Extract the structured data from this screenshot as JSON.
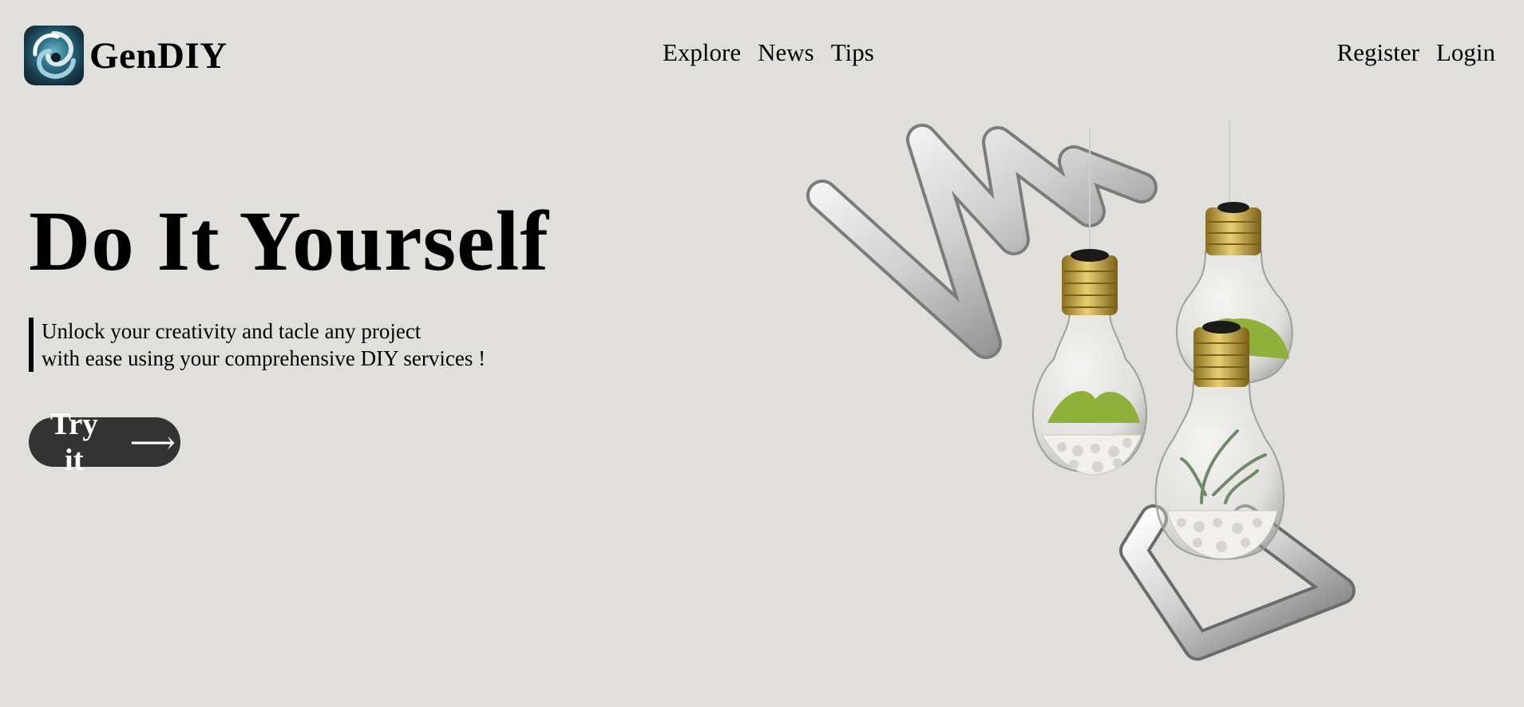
{
  "brand": {
    "name": "GenDIY",
    "logo_icon": "swirl-logo-icon"
  },
  "nav": {
    "center": [
      "Explore",
      "News",
      "Tips"
    ],
    "right": [
      "Register",
      "Login"
    ]
  },
  "hero": {
    "title": "Do It Yourself",
    "subtitle_line1": "Unlock your creativity and tacle any project",
    "subtitle_line2": "with ease using your comprehensive DIY services !",
    "cta_label": "Try it",
    "cta_arrow": "⟶",
    "cta_arrow_icon": "right-arrow-icon"
  },
  "illustration": {
    "name": "hanging-lightbulb-terrariums-image",
    "colors": {
      "background": "#e1dfdb",
      "cta": "#333333",
      "moss": "#8fb03a",
      "brass": "#c9a83e"
    }
  }
}
